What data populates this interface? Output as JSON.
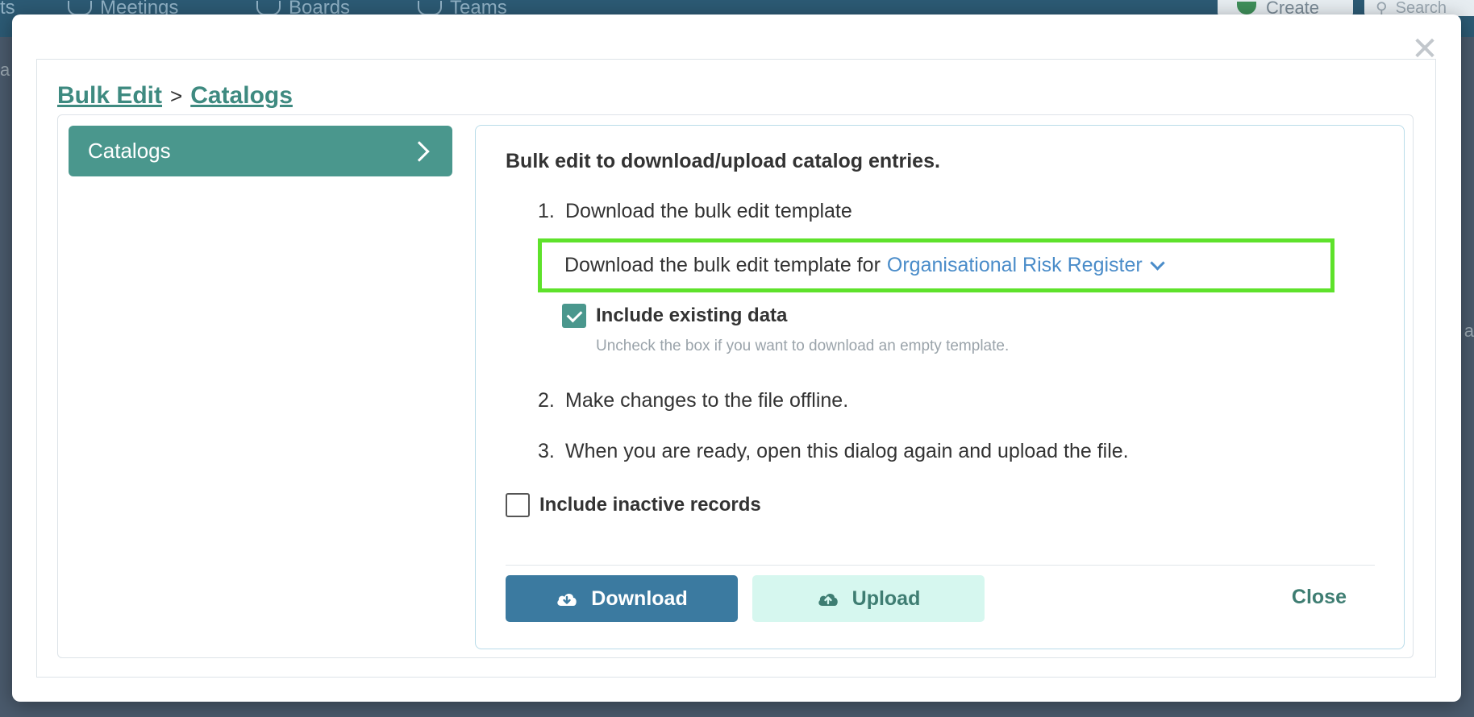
{
  "background": {
    "nav_items": [
      "Meetings",
      "Boards",
      "Teams"
    ],
    "left_fragment": "ts",
    "create_label": "Create",
    "search_placeholder": "Search",
    "side_fragment_left": "a",
    "side_fragment_right": "a"
  },
  "modal": {
    "close_glyph": "✕",
    "breadcrumb": {
      "root": "Bulk Edit",
      "separator": ">",
      "current": "Catalogs"
    },
    "sidebar": {
      "items": [
        {
          "label": "Catalogs",
          "active": true
        }
      ]
    },
    "panel": {
      "heading": "Bulk edit to download/upload catalog entries.",
      "steps": [
        {
          "num": "1.",
          "text": "Download the bulk edit template"
        },
        {
          "num": "2.",
          "text": "Make changes to the file offline."
        },
        {
          "num": "3.",
          "text": "When you are ready, open this dialog again and upload the file."
        }
      ],
      "template_prefix": "Download the bulk edit template for",
      "template_selected": "Organisational Risk Register",
      "include_existing": {
        "label": "Include existing data",
        "hint": "Uncheck the box if you want to download an empty template.",
        "checked": true
      },
      "include_inactive": {
        "label": "Include inactive records",
        "checked": false
      },
      "buttons": {
        "download": "Download",
        "upload": "Upload",
        "close": "Close"
      }
    }
  },
  "colors": {
    "accent_teal": "#4a978d",
    "download_blue": "#3b7aa0",
    "upload_bg": "#d6f7ef",
    "link_blue": "#4a8cc9",
    "highlight_green": "#5ee22b"
  }
}
